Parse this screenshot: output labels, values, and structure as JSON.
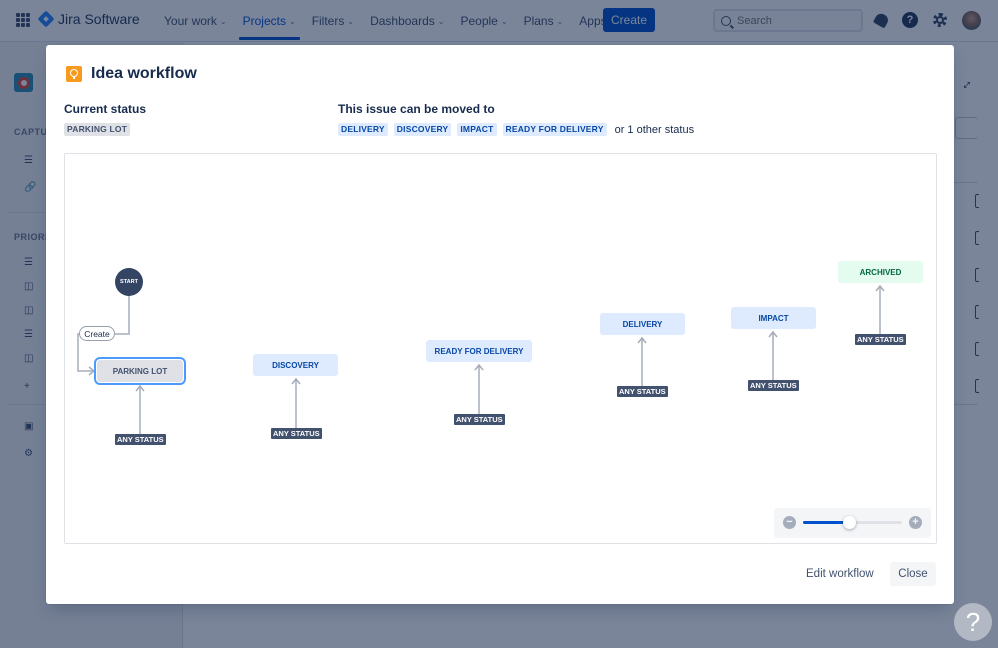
{
  "topnav": {
    "product": "Jira Software",
    "items": [
      {
        "label": "Your work",
        "active": false
      },
      {
        "label": "Projects",
        "active": true
      },
      {
        "label": "Filters",
        "active": false
      },
      {
        "label": "Dashboards",
        "active": false
      },
      {
        "label": "People",
        "active": false
      },
      {
        "label": "Plans",
        "active": false
      },
      {
        "label": "Apps",
        "active": false
      }
    ],
    "create_label": "Create",
    "search_placeholder": "Search",
    "icons": [
      "app-switcher-icon",
      "notifications-icon",
      "help-icon",
      "settings-icon",
      "profile-avatar"
    ]
  },
  "sidebar": {
    "headings": [
      "CAPTU",
      "PRIORI"
    ],
    "item_icons": [
      "list-icon",
      "link-icon",
      "list-icon",
      "board-icon",
      "board-icon",
      "list-icon",
      "board-icon",
      "plus-icon",
      "archive-icon",
      "gear-icon"
    ]
  },
  "modal": {
    "title": "Idea workflow",
    "current_status_label": "Current status",
    "current_status": "PARKING LOT",
    "moved_to_label": "This issue can be moved to",
    "moved_to": [
      "DELIVERY",
      "DISCOVERY",
      "IMPACT",
      "READY FOR DELIVERY"
    ],
    "other_text": "or 1 other status",
    "diagram": {
      "start_label": "START",
      "create_transition": "Create",
      "any_status_label": "ANY STATUS",
      "nodes": [
        {
          "label": "PARKING LOT",
          "category": "gray",
          "current": true
        },
        {
          "label": "DISCOVERY",
          "category": "blue"
        },
        {
          "label": "READY FOR DELIVERY",
          "category": "blue"
        },
        {
          "label": "DELIVERY",
          "category": "blue"
        },
        {
          "label": "IMPACT",
          "category": "blue"
        },
        {
          "label": "ARCHIVED",
          "category": "green"
        }
      ],
      "zoom_level_fraction": 0.46
    },
    "buttons": {
      "edit": "Edit workflow",
      "close": "Close"
    }
  },
  "help_fab": "?"
}
